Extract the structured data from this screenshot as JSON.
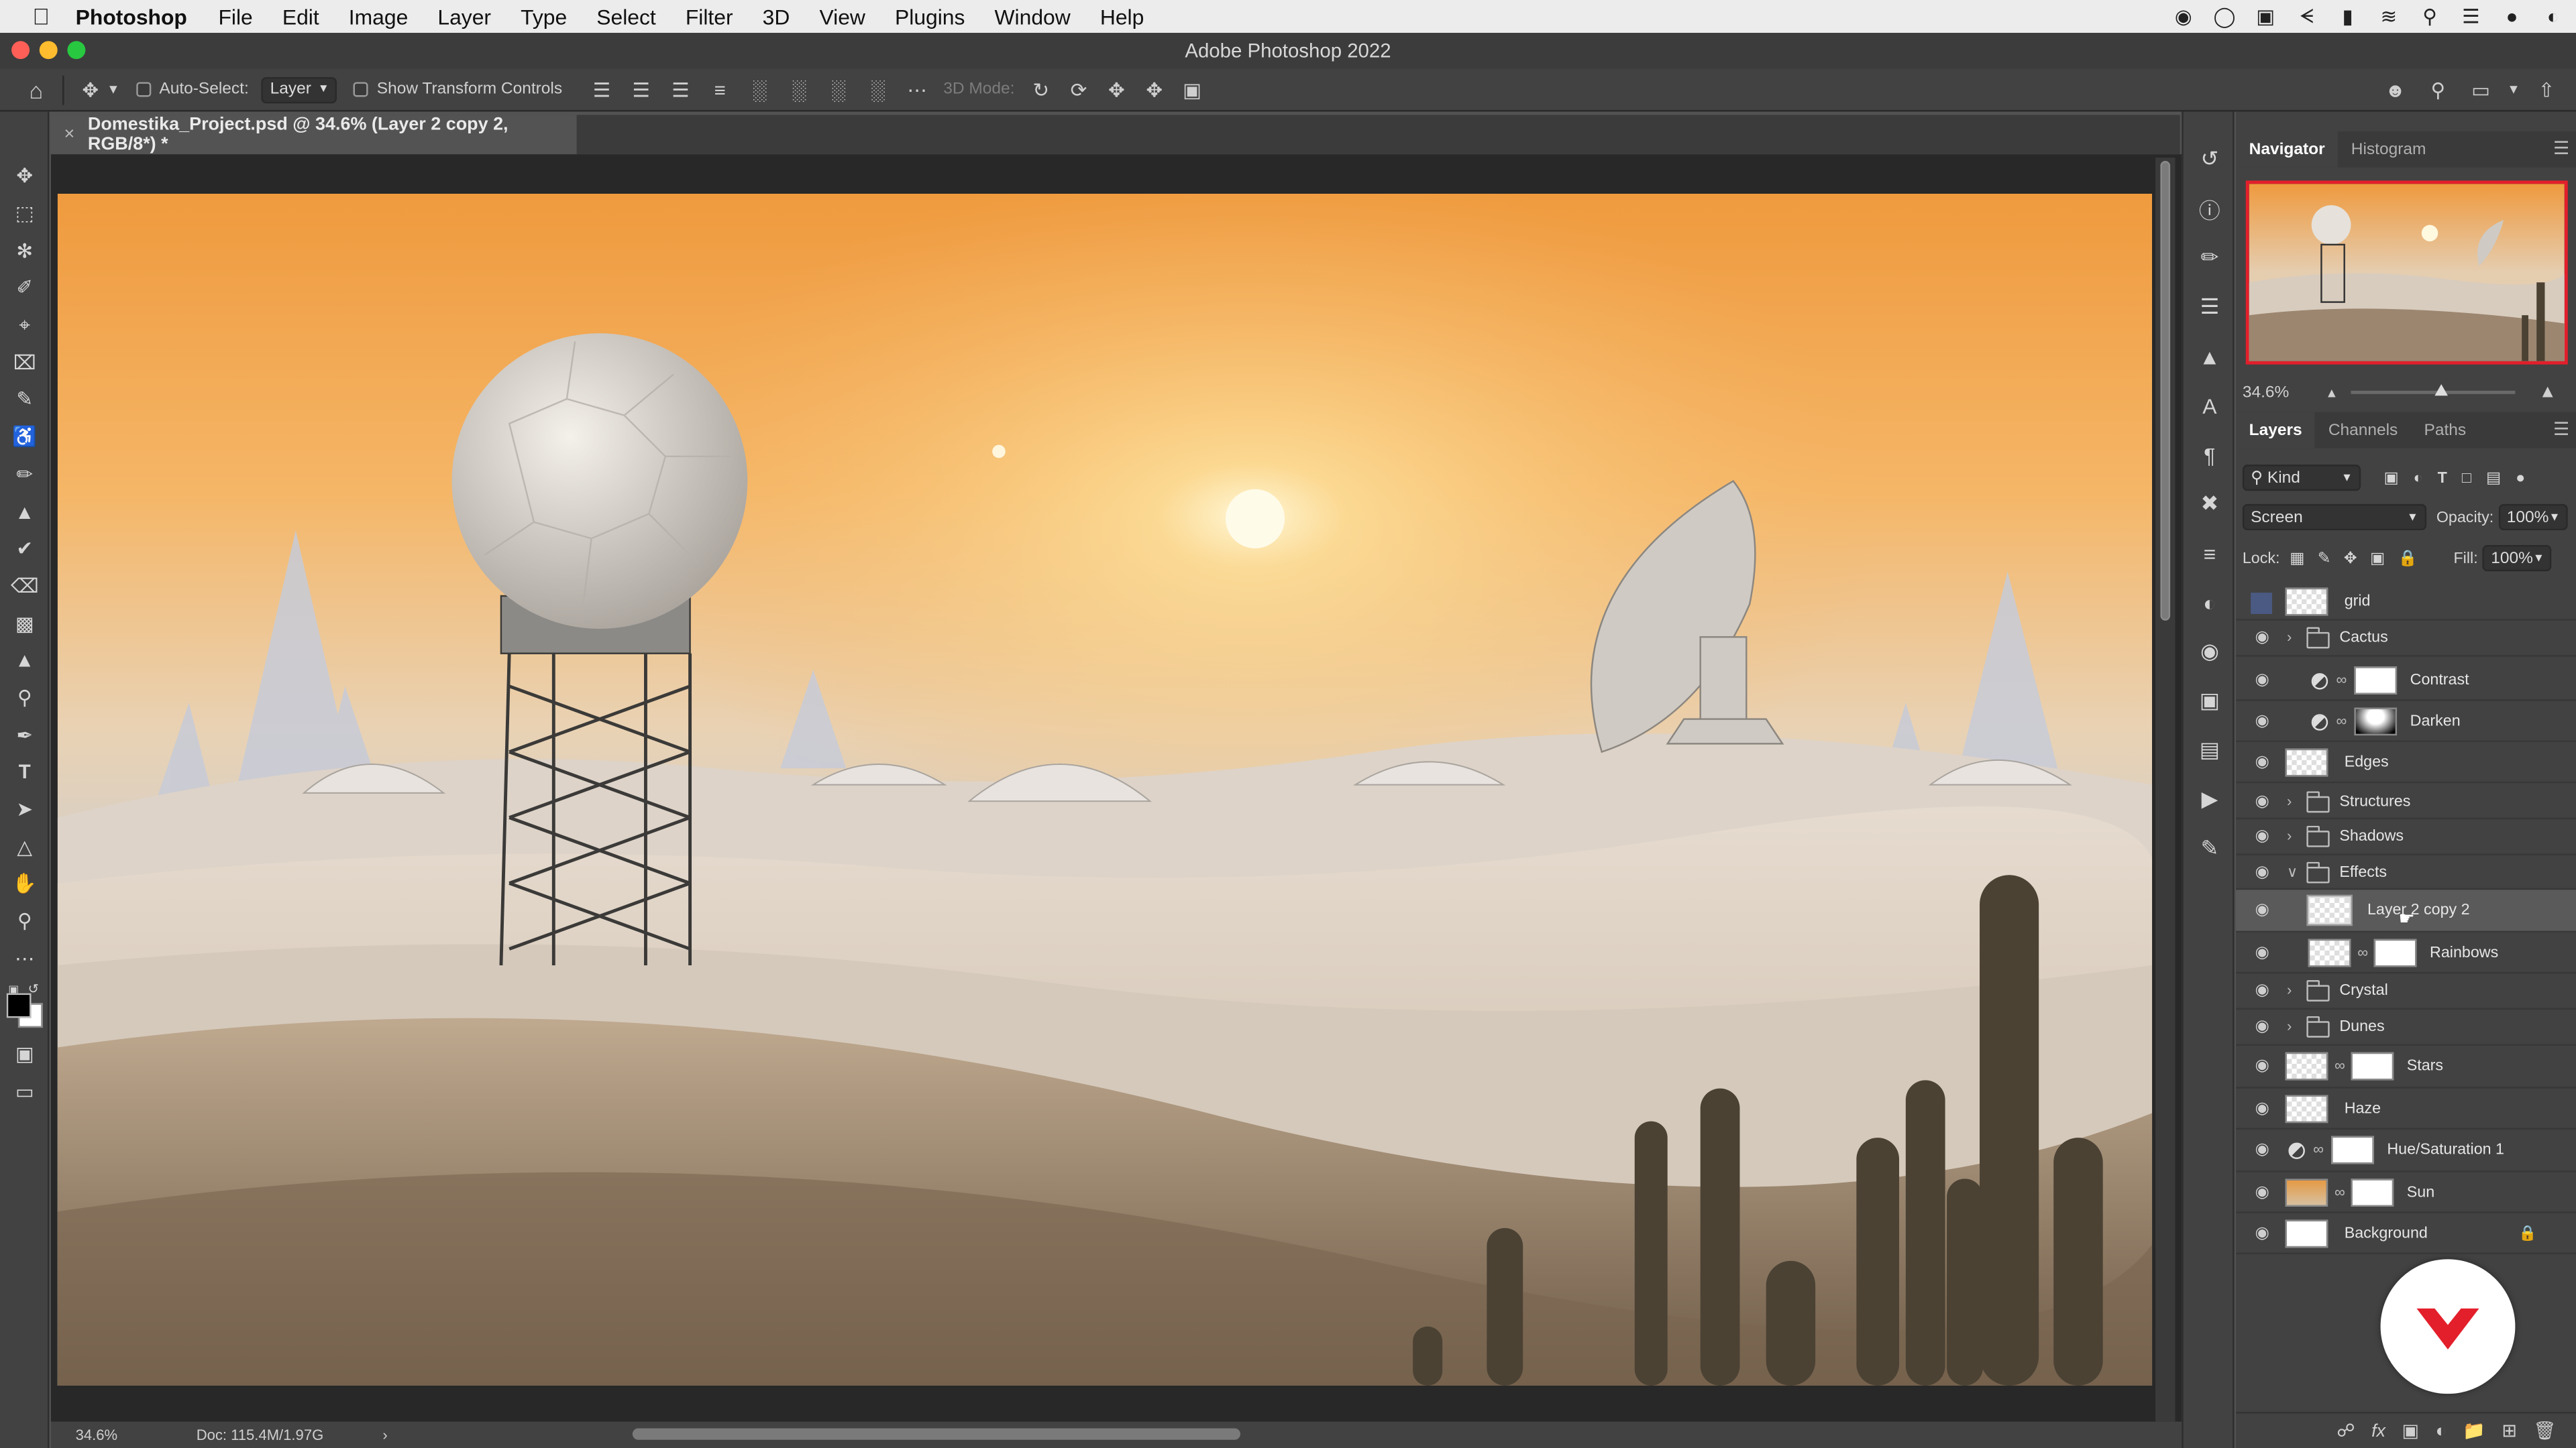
{
  "menubar": {
    "app_name": "Photoshop",
    "items": [
      "File",
      "Edit",
      "Image",
      "Layer",
      "Type",
      "Select",
      "Filter",
      "3D",
      "View",
      "Plugins",
      "Window",
      "Help"
    ]
  },
  "window": {
    "title": "Adobe Photoshop 2022"
  },
  "options_bar": {
    "auto_select_label": "Auto-Select:",
    "auto_select_value": "Layer",
    "show_transform_label": "Show Transform Controls",
    "mode_3d_label": "3D Mode:"
  },
  "document": {
    "tab_title": "Domestika_Project.psd @ 34.6% (Layer 2 copy 2, RGB/8*) *",
    "zoom": "34.6%",
    "doc_size": "Doc: 115.4M/1.97G"
  },
  "navigator": {
    "tabs": [
      "Navigator",
      "Histogram"
    ],
    "zoom": "34.6%",
    "zoom_slider_fraction": 0.55
  },
  "layers_panel": {
    "tabs": [
      "Layers",
      "Channels",
      "Paths"
    ],
    "filter_kind": "Kind",
    "blend_mode": "Screen",
    "opacity_label": "Opacity:",
    "opacity": "100%",
    "lock_label": "Lock:",
    "fill_label": "Fill:",
    "fill": "100%",
    "layers": [
      {
        "name": "grid",
        "type": "layer",
        "visible": false
      },
      {
        "name": "Cactus",
        "type": "group",
        "visible": true
      },
      {
        "name": "Contrast",
        "type": "adjust",
        "visible": true
      },
      {
        "name": "Darken",
        "type": "adjust",
        "visible": true
      },
      {
        "name": "Edges",
        "type": "layer",
        "visible": true
      },
      {
        "name": "Structures",
        "type": "group",
        "visible": true
      },
      {
        "name": "Shadows",
        "type": "group",
        "visible": true
      },
      {
        "name": "Effects",
        "type": "group-open",
        "visible": true
      },
      {
        "name": "Layer 2 copy 2",
        "type": "layer-selected",
        "visible": true
      },
      {
        "name": "Rainbows",
        "type": "masked",
        "visible": true
      },
      {
        "name": "Crystal",
        "type": "group",
        "visible": true
      },
      {
        "name": "Dunes",
        "type": "group",
        "visible": true
      },
      {
        "name": "Stars",
        "type": "masked",
        "visible": true
      },
      {
        "name": "Haze",
        "type": "layer",
        "visible": true
      },
      {
        "name": "Hue/Saturation 1",
        "type": "adjust",
        "visible": true
      },
      {
        "name": "Sun",
        "type": "masked",
        "visible": true
      },
      {
        "name": "Background",
        "type": "background",
        "visible": true
      }
    ]
  },
  "colors": {
    "accent_red": "#e31f2b",
    "selected_row": "#5a5a5a",
    "panel_bg": "#424242"
  }
}
